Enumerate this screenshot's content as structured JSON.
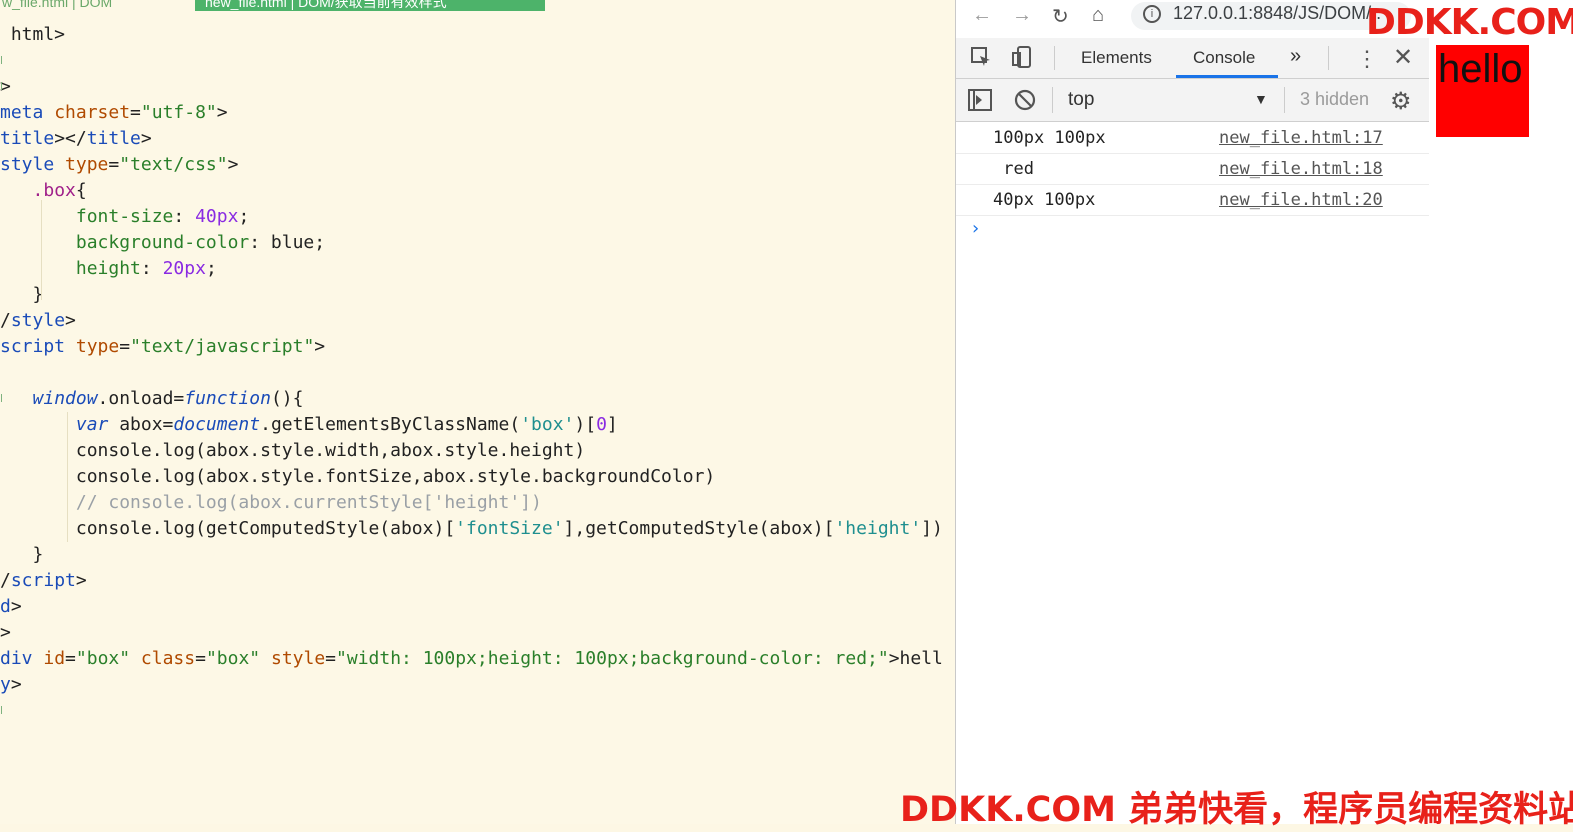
{
  "editor": {
    "tab_inactive": "w_file.html | DOM",
    "tab_active": "new_file.html | DOM/获取当前有效样式",
    "lines": [
      {
        "parts": [
          [
            "punc",
            " html>"
          ]
        ]
      },
      {
        "parts": [
          [
            "punc",
            ""
          ]
        ]
      },
      {
        "parts": [
          [
            "punc",
            ">"
          ]
        ]
      },
      {
        "parts": [
          [
            "tag",
            "meta "
          ],
          [
            "attr",
            "charset"
          ],
          [
            "punc",
            "="
          ],
          [
            "str",
            "\"utf-8\""
          ],
          [
            "punc",
            ">"
          ]
        ]
      },
      {
        "parts": [
          [
            "tag",
            "title"
          ],
          [
            "punc",
            "></"
          ],
          [
            "tag",
            "title"
          ],
          [
            "punc",
            ">"
          ]
        ]
      },
      {
        "parts": [
          [
            "tag",
            "style "
          ],
          [
            "attr",
            "type"
          ],
          [
            "punc",
            "="
          ],
          [
            "str",
            "\"text/css\""
          ],
          [
            "punc",
            ">"
          ]
        ]
      },
      {
        "parts": [
          [
            "punc",
            "   "
          ],
          [
            "sel",
            ".box"
          ],
          [
            "punc",
            "{"
          ]
        ]
      },
      {
        "parts": [
          [
            "punc",
            "       "
          ],
          [
            "prop",
            "font-size"
          ],
          [
            "punc",
            ": "
          ],
          [
            "num",
            "40px"
          ],
          [
            "punc",
            ";"
          ]
        ]
      },
      {
        "parts": [
          [
            "punc",
            "       "
          ],
          [
            "prop",
            "background-color"
          ],
          [
            "punc",
            ": blue;"
          ]
        ]
      },
      {
        "parts": [
          [
            "punc",
            "       "
          ],
          [
            "prop",
            "height"
          ],
          [
            "punc",
            ": "
          ],
          [
            "num",
            "20px"
          ],
          [
            "punc",
            ";"
          ]
        ]
      },
      {
        "parts": [
          [
            "punc",
            "   }"
          ]
        ]
      },
      {
        "parts": [
          [
            "punc",
            "/"
          ],
          [
            "tag",
            "style"
          ],
          [
            "punc",
            ">"
          ]
        ]
      },
      {
        "parts": [
          [
            "tag",
            "script "
          ],
          [
            "attr",
            "type"
          ],
          [
            "punc",
            "="
          ],
          [
            "str",
            "\"text/javascript\""
          ],
          [
            "punc",
            ">"
          ]
        ]
      },
      {
        "parts": [
          [
            "punc",
            ""
          ]
        ]
      },
      {
        "parts": [
          [
            "punc",
            "   "
          ],
          [
            "obj",
            "window"
          ],
          [
            "punc",
            ".onload="
          ],
          [
            "kw",
            "function"
          ],
          [
            "punc",
            "(){"
          ]
        ]
      },
      {
        "parts": [
          [
            "punc",
            "       "
          ],
          [
            "kw",
            "var"
          ],
          [
            "punc",
            " abox="
          ],
          [
            "obj",
            "document"
          ],
          [
            "punc",
            ".getElementsByClassName("
          ],
          [
            "sq",
            "'box'"
          ],
          [
            "punc",
            ")["
          ],
          [
            "num",
            "0"
          ],
          [
            "punc",
            "]"
          ]
        ]
      },
      {
        "parts": [
          [
            "punc",
            "       console.log(abox.style.width,abox.style.height)"
          ]
        ]
      },
      {
        "parts": [
          [
            "punc",
            "       console.log(abox.style.fontSize,abox.style.backgroundColor)"
          ]
        ]
      },
      {
        "parts": [
          [
            "cmt",
            "       // console.log(abox.currentStyle['height'])"
          ]
        ]
      },
      {
        "parts": [
          [
            "punc",
            "       console.log(getComputedStyle(abox)["
          ],
          [
            "sq",
            "'fontSize'"
          ],
          [
            "punc",
            "],getComputedStyle(abox)["
          ],
          [
            "sq",
            "'height'"
          ],
          [
            "punc",
            "])"
          ]
        ]
      },
      {
        "parts": [
          [
            "punc",
            "   }"
          ]
        ]
      },
      {
        "parts": [
          [
            "punc",
            "/"
          ],
          [
            "tag",
            "script"
          ],
          [
            "punc",
            ">"
          ]
        ]
      },
      {
        "parts": [
          [
            "tag",
            "d"
          ],
          [
            "punc",
            ">"
          ]
        ]
      },
      {
        "parts": [
          [
            "punc",
            ">"
          ]
        ]
      },
      {
        "parts": [
          [
            "tag",
            "div "
          ],
          [
            "attr",
            "id"
          ],
          [
            "punc",
            "="
          ],
          [
            "str",
            "\"box\" "
          ],
          [
            "attr",
            "class"
          ],
          [
            "punc",
            "="
          ],
          [
            "str",
            "\"box\" "
          ],
          [
            "attr",
            "style"
          ],
          [
            "punc",
            "="
          ],
          [
            "str",
            "\"width: 100px;height: 100px;background-color: red;\""
          ],
          [
            "punc",
            ">hell"
          ]
        ]
      },
      {
        "parts": [
          [
            "tag",
            "y"
          ],
          [
            "punc",
            ">"
          ]
        ]
      }
    ]
  },
  "browser": {
    "url": "127.0.0.1:8848/JS/DOM/..",
    "back_icon": "arrow-left-icon",
    "forward_icon": "arrow-right-icon",
    "reload_icon": "reload-icon",
    "home_icon": "home-icon"
  },
  "devtools": {
    "tabs": [
      "Elements",
      "Console"
    ],
    "active_tab": "Console",
    "more_tabs": "»",
    "context": "top",
    "hidden_label": "3 hidden",
    "messages": [
      {
        "text": "100px 100px",
        "source": "new_file.html:17"
      },
      {
        "text": " red",
        "source": "new_file.html:18"
      },
      {
        "text": "40px 100px",
        "source": "new_file.html:20"
      }
    ],
    "prompt": "›"
  },
  "page_preview": {
    "hello_text": "hello",
    "box_color": "#ff0000"
  },
  "watermarks": {
    "top": "DDKK.COM",
    "bottom": "DDKK.COM 弟弟快看，程序员编程资料站"
  }
}
